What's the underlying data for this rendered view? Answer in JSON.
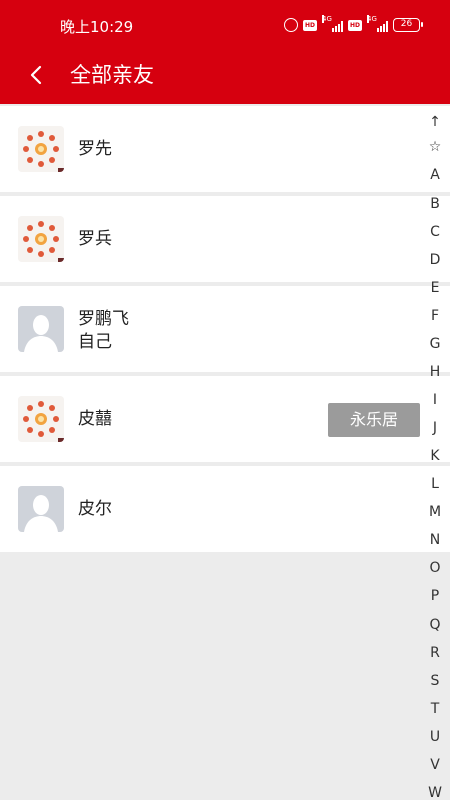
{
  "status_bar": {
    "time": "晚上10:29",
    "battery": "26",
    "network_1": "4G",
    "network_2": "4G",
    "icons": [
      "alarm-icon",
      "hd-icon",
      "signal-icon",
      "hd-icon",
      "signal-icon",
      "battery-icon"
    ]
  },
  "header": {
    "title": "全部亲友",
    "back_icon": "chevron-left-icon",
    "background": "#d6000f"
  },
  "contacts": [
    {
      "name": "罗先",
      "subtitle": "",
      "avatar": "flower-avatar"
    },
    {
      "name": "罗兵",
      "subtitle": "",
      "avatar": "flower-avatar"
    },
    {
      "name": "罗鹏飞",
      "subtitle": "自己",
      "avatar": "default-avatar"
    },
    {
      "name": "皮囍",
      "subtitle": "",
      "avatar": "flower-avatar",
      "tag": "永乐居"
    },
    {
      "name": "皮尔",
      "subtitle": "",
      "avatar": "default-avatar"
    }
  ],
  "index_bar": [
    "↑",
    "☆",
    "A",
    "B",
    "C",
    "D",
    "E",
    "F",
    "G",
    "H",
    "I",
    "J",
    "K",
    "L",
    "M",
    "N",
    "O",
    "P",
    "Q",
    "R",
    "S",
    "T",
    "U",
    "V",
    "W"
  ]
}
